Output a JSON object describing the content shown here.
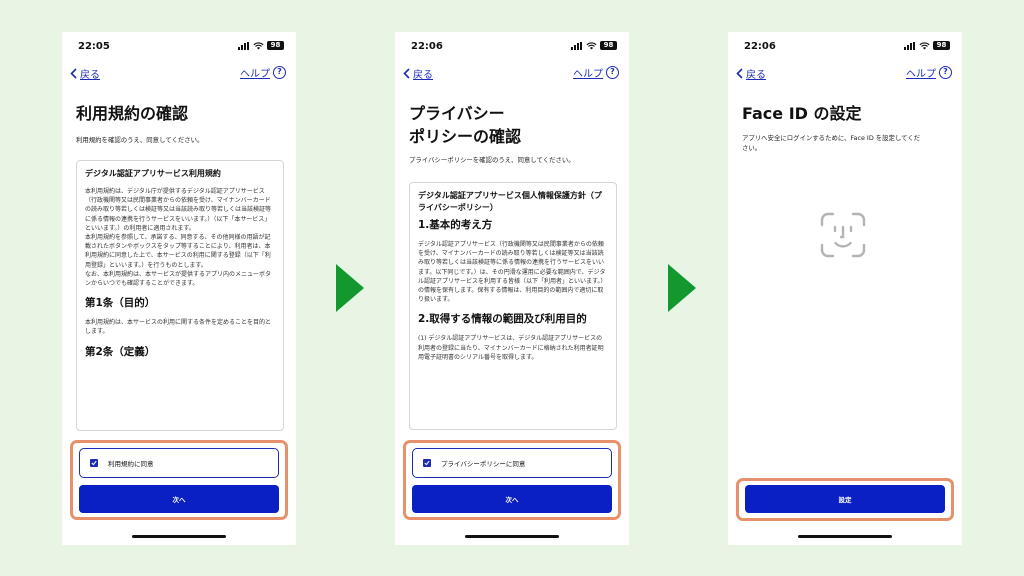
{
  "colors": {
    "background": "#e9f5e4",
    "accent": "#0a1fc4",
    "link": "#1b2bb8",
    "highlight": "#e6906c",
    "arrow": "#12982f"
  },
  "screens": [
    {
      "status": {
        "time": "22:05",
        "battery": "98"
      },
      "nav": {
        "back_label": "戻る",
        "help_label": "ヘルプ",
        "help_icon": "question-circle-icon"
      },
      "title": "利用規約の確認",
      "subtitle": "利用規約を確認のうえ、同意してください。",
      "document": {
        "heading": "デジタル認証アプリサービス利用規約",
        "paragraphs": [
          "本利用規約は、デジタル庁が提供するデジタル認証アプリサービス（行政機関等又は民間事業者からの依頼を受け、マイナンバーカードの読み取り等若しくは検証等又は当該読み取り等若しくは当該検証等に係る情報の連携を行うサービスをいいます。）（以下「本サービス」といいます。）の利用者に適用されます。",
          "本利用規約を参照して、承諾する、同意する、その他同様の用語が記載されたボタンやボックスをタップ等することにより、利用者は、本利用規約に同意した上で、本サービスの利用に関する登録（以下「利用登録」といいます。）を行うものとします。",
          "なお、本利用規約は、本サービスが提供するアプリ内のメニューボタンからいつでも確認することができます。"
        ],
        "section1_title": "第1条（目的）",
        "section1_text": "本利用規約は、本サービスの利用に関する条件を定めることを目的とします。",
        "section2_title": "第2条（定義）"
      },
      "agree_label": "利用規約に同意",
      "button_label": "次へ"
    },
    {
      "status": {
        "time": "22:06",
        "battery": "98"
      },
      "nav": {
        "back_label": "戻る",
        "help_label": "ヘルプ",
        "help_icon": "question-circle-icon"
      },
      "title_line1": "プライバシー",
      "title_line2": "ポリシーの確認",
      "subtitle": "プライバシーポリシーを確認のうえ、同意してください。",
      "document": {
        "heading": "デジタル認証アプリサービス個人情報保護方針（プライバシーポリシー）",
        "section1_title": "1.基本的考え方",
        "section1_text": "デジタル認証アプリサービス（行政機関等又は民間事業者からの依頼を受け、マイナンバーカードの読み取り等若しくは検証等又は当該読み取り等若しくは当該検証等に係る情報の連携を行うサービスをいいます。以下同じです。）は、その円滑な運用に必要な範囲内で、デジタル認証アプリサービスを利用する皆様（以下「利用者」といいます。）の情報を保有します。保有する情報は、利用目的の範囲内で適切に取り扱います。",
        "section2_title": "2.取得する情報の範囲及び利用目的",
        "section2_text": "(1) デジタル認証アプリサービスは、デジタル認証アプリサービスの利用者の登録に当たり、マイナンバーカードに格納された利用者証明用電子証明書のシリアル番号を取得します。"
      },
      "agree_label": "プライバシーポリシーに同意",
      "button_label": "次へ"
    },
    {
      "status": {
        "time": "22:06",
        "battery": "98"
      },
      "nav": {
        "back_label": "戻る",
        "help_label": "ヘルプ",
        "help_icon": "question-circle-icon"
      },
      "title": "Face ID の設定",
      "subtitle": "アプリへ安全にログインするために、Face ID を設定してください。",
      "face_icon": "face-id-icon",
      "button_label": "設定"
    }
  ]
}
